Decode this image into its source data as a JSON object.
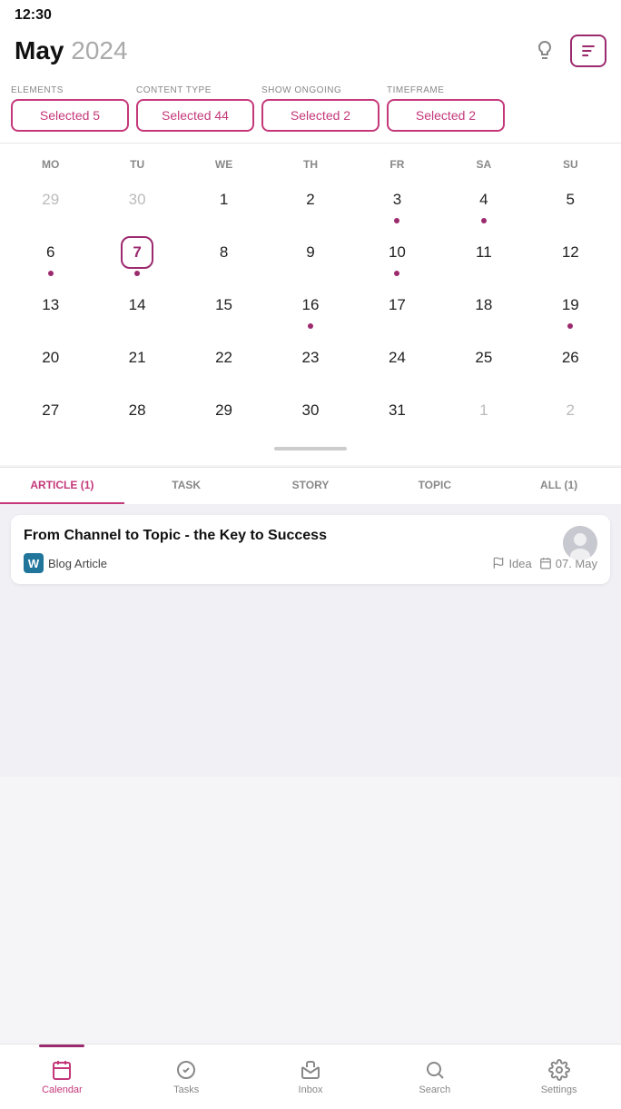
{
  "statusBar": {
    "time": "12:30"
  },
  "header": {
    "month": "May",
    "year": "2024",
    "lightbulbIcon": "💡",
    "filterIcon": "⚙"
  },
  "filters": [
    {
      "label": "ELEMENTS",
      "value": "Selected 5"
    },
    {
      "label": "CONTENT TYPE",
      "value": "Selected 44"
    },
    {
      "label": "SHOW ONGOING",
      "value": "Selected 2"
    },
    {
      "label": "TIMEFRAME",
      "value": "Selected 2"
    }
  ],
  "calendar": {
    "weekdays": [
      "MO",
      "TU",
      "WE",
      "TH",
      "FR",
      "SA",
      "SU"
    ],
    "weeks": [
      [
        {
          "num": "29",
          "faded": true,
          "dot": false,
          "selected": false
        },
        {
          "num": "30",
          "faded": true,
          "dot": false,
          "selected": false
        },
        {
          "num": "1",
          "faded": false,
          "dot": false,
          "selected": false
        },
        {
          "num": "2",
          "faded": false,
          "dot": false,
          "selected": false
        },
        {
          "num": "3",
          "faded": false,
          "dot": true,
          "selected": false
        },
        {
          "num": "4",
          "faded": false,
          "dot": true,
          "selected": false
        },
        {
          "num": "5",
          "faded": false,
          "dot": false,
          "selected": false
        }
      ],
      [
        {
          "num": "6",
          "faded": false,
          "dot": true,
          "selected": false
        },
        {
          "num": "7",
          "faded": false,
          "dot": true,
          "selected": true
        },
        {
          "num": "8",
          "faded": false,
          "dot": false,
          "selected": false
        },
        {
          "num": "9",
          "faded": false,
          "dot": false,
          "selected": false
        },
        {
          "num": "10",
          "faded": false,
          "dot": true,
          "selected": false
        },
        {
          "num": "11",
          "faded": false,
          "dot": false,
          "selected": false
        },
        {
          "num": "12",
          "faded": false,
          "dot": false,
          "selected": false
        }
      ],
      [
        {
          "num": "13",
          "faded": false,
          "dot": false,
          "selected": false
        },
        {
          "num": "14",
          "faded": false,
          "dot": false,
          "selected": false
        },
        {
          "num": "15",
          "faded": false,
          "dot": false,
          "selected": false
        },
        {
          "num": "16",
          "faded": false,
          "dot": true,
          "selected": false
        },
        {
          "num": "17",
          "faded": false,
          "dot": false,
          "selected": false
        },
        {
          "num": "18",
          "faded": false,
          "dot": false,
          "selected": false
        },
        {
          "num": "19",
          "faded": false,
          "dot": true,
          "selected": false
        }
      ],
      [
        {
          "num": "20",
          "faded": false,
          "dot": false,
          "selected": false
        },
        {
          "num": "21",
          "faded": false,
          "dot": false,
          "selected": false
        },
        {
          "num": "22",
          "faded": false,
          "dot": false,
          "selected": false
        },
        {
          "num": "23",
          "faded": false,
          "dot": false,
          "selected": false
        },
        {
          "num": "24",
          "faded": false,
          "dot": false,
          "selected": false
        },
        {
          "num": "25",
          "faded": false,
          "dot": false,
          "selected": false
        },
        {
          "num": "26",
          "faded": false,
          "dot": false,
          "selected": false
        }
      ],
      [
        {
          "num": "27",
          "faded": false,
          "dot": false,
          "selected": false
        },
        {
          "num": "28",
          "faded": false,
          "dot": false,
          "selected": false
        },
        {
          "num": "29",
          "faded": false,
          "dot": false,
          "selected": false
        },
        {
          "num": "30",
          "faded": false,
          "dot": false,
          "selected": false
        },
        {
          "num": "31",
          "faded": false,
          "dot": false,
          "selected": false
        },
        {
          "num": "1",
          "faded": true,
          "dot": false,
          "selected": false
        },
        {
          "num": "2",
          "faded": true,
          "dot": false,
          "selected": false
        }
      ]
    ]
  },
  "contentTabs": [
    {
      "label": "ARTICLE (1)",
      "active": true
    },
    {
      "label": "TASK",
      "active": false
    },
    {
      "label": "STORY",
      "active": false
    },
    {
      "label": "TOPIC",
      "active": false
    },
    {
      "label": "ALL (1)",
      "active": false
    }
  ],
  "article": {
    "title": "From Channel to Topic - the Key to Success",
    "type": "Blog Article",
    "idea": "Idea",
    "date": "07. May"
  },
  "bottomNav": [
    {
      "label": "Calendar",
      "active": true,
      "icon": "calendar"
    },
    {
      "label": "Tasks",
      "active": false,
      "icon": "tasks"
    },
    {
      "label": "Inbox",
      "active": false,
      "icon": "inbox"
    },
    {
      "label": "Search",
      "active": false,
      "icon": "search"
    },
    {
      "label": "Settings",
      "active": false,
      "icon": "settings"
    }
  ]
}
